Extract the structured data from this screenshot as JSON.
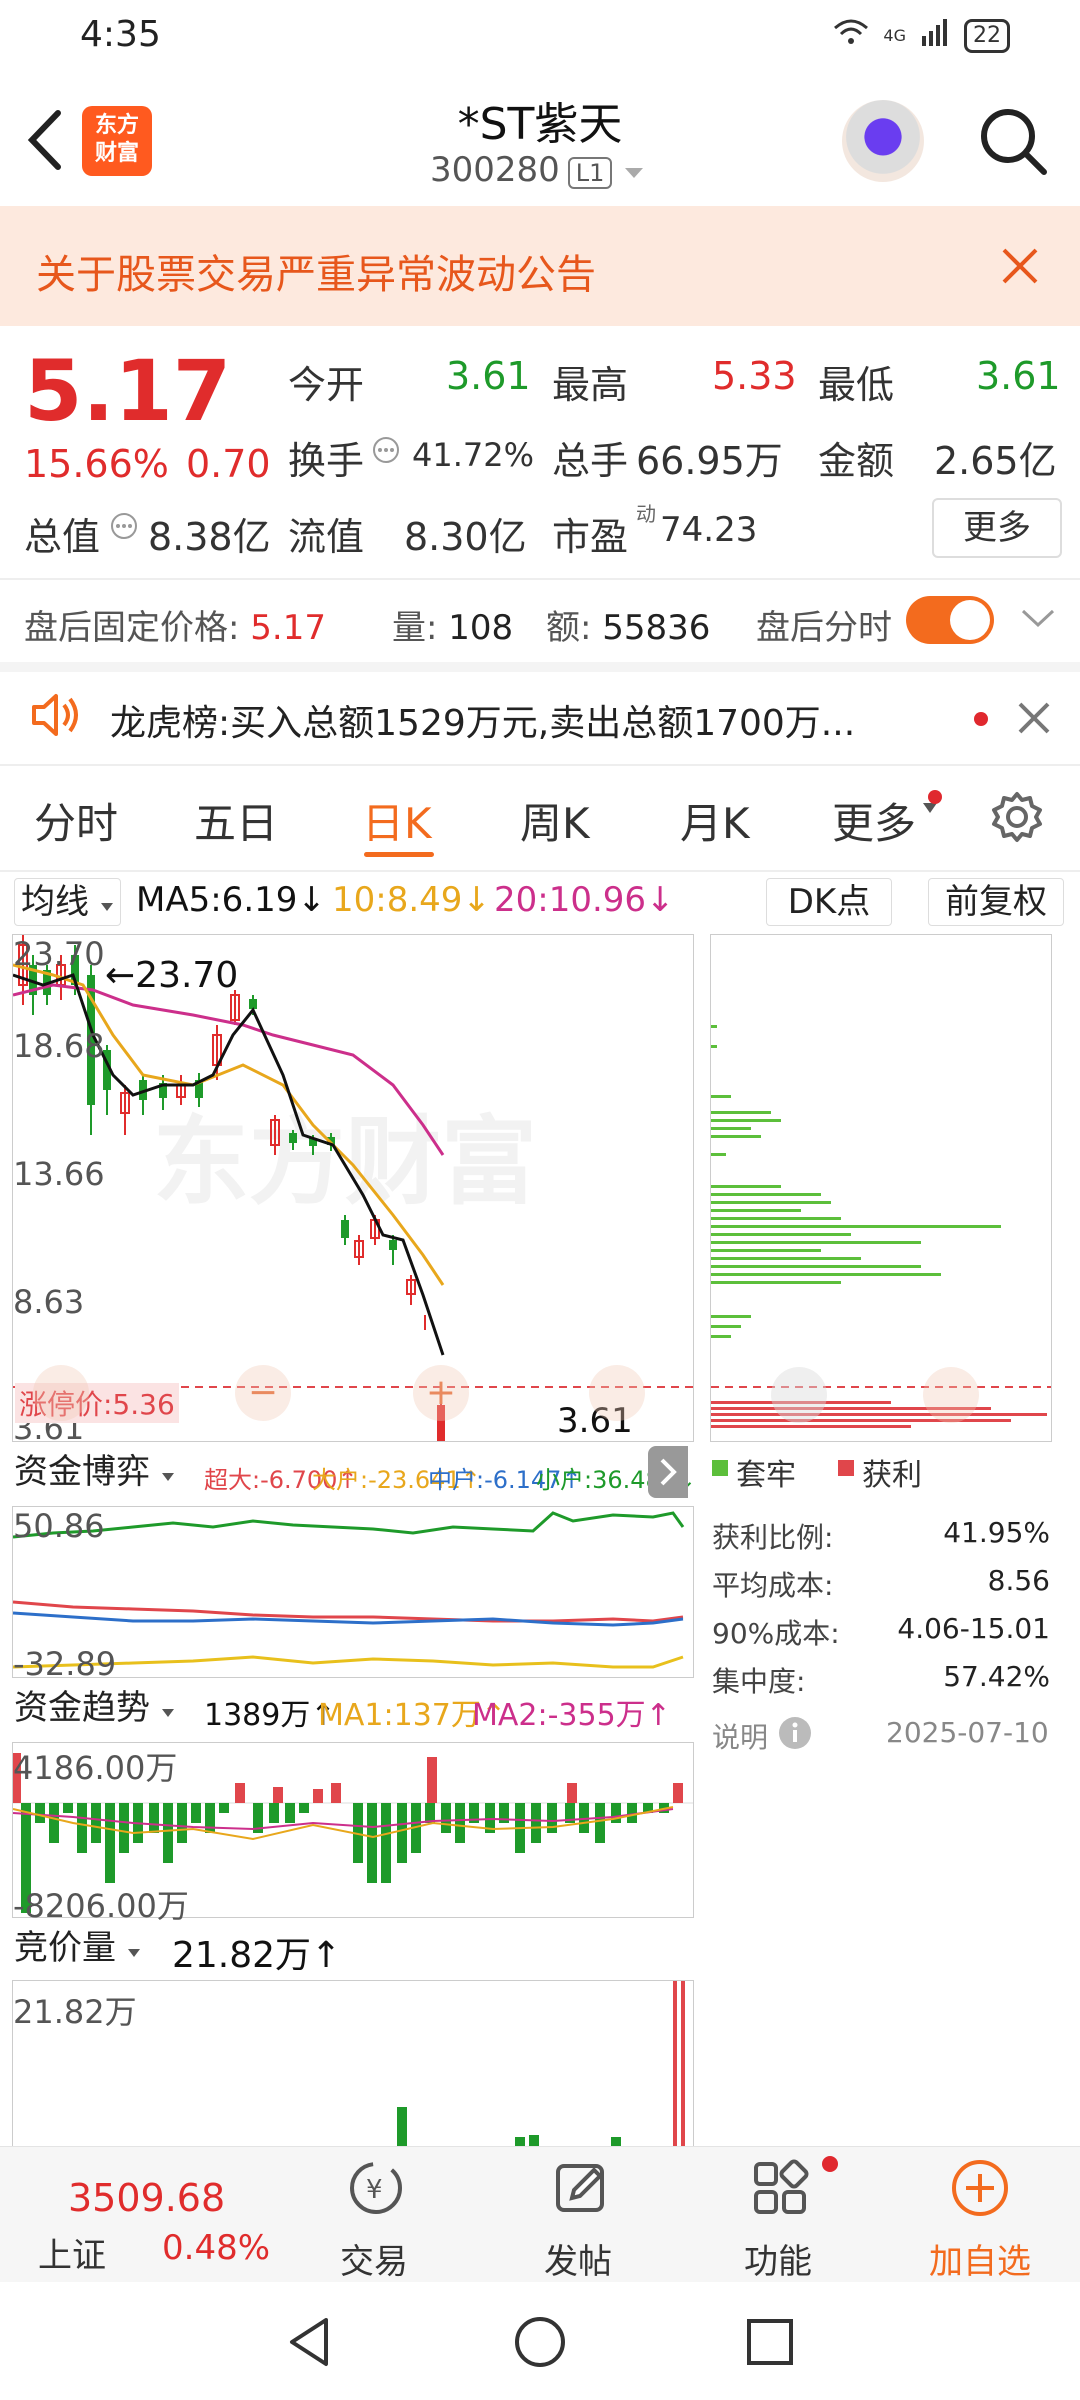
{
  "status_bar": {
    "time": "4:35",
    "network": "4G",
    "battery": "22"
  },
  "nav": {
    "title": "*ST紫天",
    "code": "300280",
    "code_badge": "L1",
    "logo_text": "东方财富"
  },
  "announcement": {
    "text": "关于股票交易严重异常波动公告"
  },
  "quote": {
    "price": "5.17",
    "pct_change": "15.66%",
    "change": "0.70",
    "fields": {
      "open_label": "今开",
      "open": "3.61",
      "high_label": "最高",
      "high": "5.33",
      "low_label": "最低",
      "low": "3.61",
      "turnover_label": "换手",
      "turnover": "41.72%",
      "volume_label": "总手",
      "volume": "66.95万",
      "amount_label": "金额",
      "amount": "2.65亿",
      "mktcap_label": "总值",
      "mktcap": "8.38亿",
      "float_label": "流值",
      "float": "8.30亿",
      "pe_label": "市盈",
      "pe_sup": "动",
      "pe": "74.23"
    },
    "more_label": "更多"
  },
  "after_hours": {
    "price_label": "盘后固定价格:",
    "price": "5.17",
    "vol_label": "量:",
    "vol": "108",
    "amt_label": "额:",
    "amt": "55836",
    "toggle_label": "盘后分时",
    "toggle_on": true
  },
  "dragon_tiger": {
    "text": "龙虎榜:买入总额1529万元,卖出总额1700万..."
  },
  "tabs": [
    "分时",
    "五日",
    "日K",
    "周K",
    "月K",
    "更多"
  ],
  "active_tab": "日K",
  "indicators": {
    "ma_label": "均线",
    "ma5": "MA5:6.19↓",
    "ma10": "10:8.49↓",
    "ma20": "20:10.96↓",
    "dk_label": "DK点",
    "adj_label": "前复权",
    "colors": {
      "ma5": "#111111",
      "ma10": "#e8a71c",
      "ma20": "#cc2f8b"
    }
  },
  "kline": {
    "y_labels": [
      "23.70",
      "18.68",
      "13.66",
      "8.63",
      "3.61"
    ],
    "high_marker": "←23.70",
    "low_marker": "3.61",
    "limit_up_label": "涨停价:5.36",
    "watermark": "东方财富"
  },
  "chip_legend": {
    "trapped": "套牢",
    "profit": "获利",
    "trapped_color": "#5cbf3b",
    "profit_color": "#e0464b"
  },
  "chip_stats": [
    {
      "label": "获利比例:",
      "value": "41.95%"
    },
    {
      "label": "平均成本:",
      "value": "8.56"
    },
    {
      "label": "90%成本:",
      "value": "4.06-15.01"
    },
    {
      "label": "集中度:",
      "value": "57.42%"
    }
  ],
  "chip_note": {
    "label": "说明",
    "date": "2025-07-10"
  },
  "fund_game": {
    "title": "资金博弈",
    "super": "超大:-6.700↑",
    "big": "大户:-23.641↑",
    "mid": "中户:-6.147↑",
    "small": "小户:36.488↓",
    "y_top": "50.86",
    "y_bottom": "-32.89"
  },
  "fund_trend": {
    "title": "资金趋势",
    "value": "1389万↑",
    "ma1": "MA1:137万↑",
    "ma2": "MA2:-355万↑",
    "y_top": "4186.00万",
    "y_bottom": "-8206.00万"
  },
  "auction": {
    "title": "竞价量",
    "value": "21.82万↑",
    "y_top": "21.82万"
  },
  "bottom_bar": {
    "index_value": "3509.68",
    "index_name": "上证",
    "index_pct": "0.48%",
    "items": [
      "交易",
      "发帖",
      "功能",
      "加自选"
    ]
  }
}
